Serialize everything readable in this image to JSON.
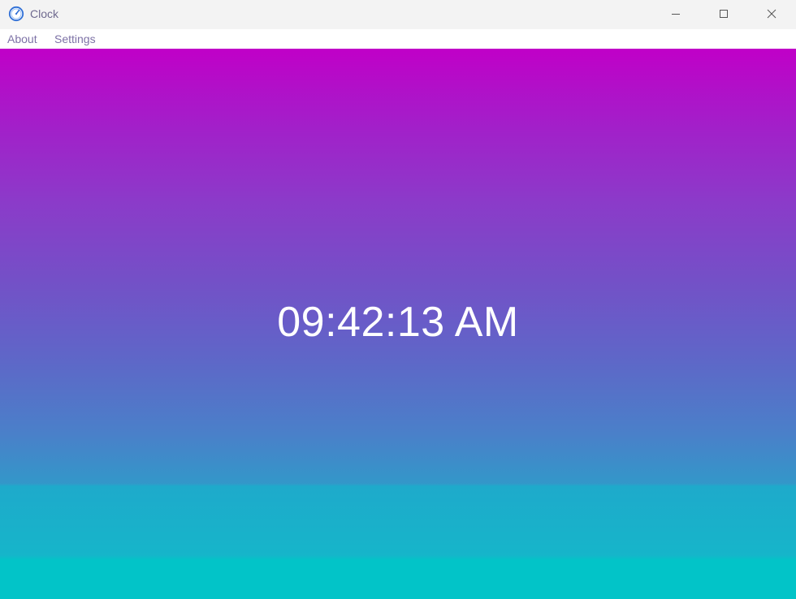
{
  "window": {
    "title": "Clock",
    "icon": "clock-icon",
    "controls": {
      "minimize_icon": "minimize-icon",
      "maximize_icon": "maximize-icon",
      "close_icon": "close-icon"
    }
  },
  "menu": {
    "items": [
      {
        "label": "About"
      },
      {
        "label": "Settings"
      }
    ]
  },
  "clock": {
    "time": "09:42:13 AM"
  },
  "colors": {
    "gradient_top": "#c000c8",
    "gradient_bottom": "#02c4c8",
    "clock_text": "#ffffff",
    "menu_text": "#7d72a6",
    "titlebar_bg": "#f3f3f3"
  }
}
